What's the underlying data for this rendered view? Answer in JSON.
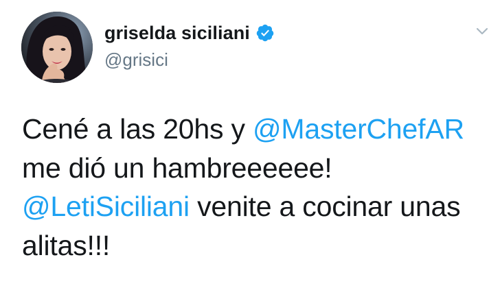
{
  "author": {
    "display_name": "griselda siciliani",
    "handle": "@grisici",
    "verified": true,
    "avatar_icon": "profile-photo"
  },
  "tweet": {
    "text_part1": "Cené a las 20hs y ",
    "mention1": "@MasterChefAR",
    "text_part2": " me dió un hambreeeeee! ",
    "mention2": "@LetiSiciliani",
    "text_part3": " venite a cocinar unas alitas!!!"
  },
  "colors": {
    "mention": "#1da1f2",
    "verified_badge": "#1da1f2",
    "handle": "#657786",
    "text": "#14171a"
  },
  "icons": {
    "verified": "verified-badge-icon",
    "menu": "chevron-down-icon"
  }
}
